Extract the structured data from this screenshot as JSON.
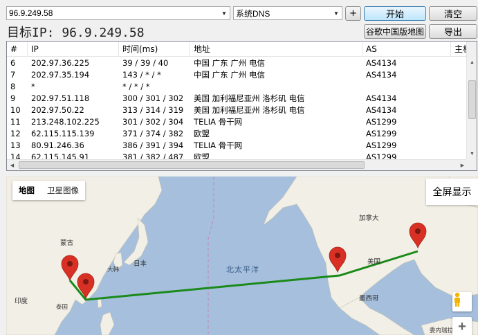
{
  "toolbar": {
    "target_value": "96.9.249.58",
    "dns_value": "系统DNS",
    "plus_label": "+",
    "start_label": "开始",
    "clear_label": "清空",
    "google_map_label": "谷歌中国版地图",
    "export_label": "导出"
  },
  "target_label": "目标IP: 96.9.249.58",
  "table": {
    "headers": [
      "#",
      "IP",
      "时间(ms)",
      "地址",
      "AS",
      "主机"
    ],
    "rows": [
      [
        "6",
        "202.97.36.225",
        "39 / 39 / 40",
        "中国 广东 广州 电信",
        "AS4134"
      ],
      [
        "7",
        "202.97.35.194",
        "143 / * / *",
        "中国 广东 广州 电信",
        "AS4134"
      ],
      [
        "8",
        "*",
        "* / * / *",
        "",
        ""
      ],
      [
        "9",
        "202.97.51.118",
        "300 / 301 / 302",
        "美国 加利福尼亚州 洛杉矶 电信",
        "AS4134"
      ],
      [
        "10",
        "202.97.50.22",
        "313 / 314 / 319",
        "美国 加利福尼亚州 洛杉矶 电信",
        "AS4134"
      ],
      [
        "11",
        "213.248.102.225",
        "301 / 302 / 304",
        "TELIA 骨干网",
        "AS1299"
      ],
      [
        "12",
        "62.115.115.139",
        "371 / 374 / 382",
        "欧盟",
        "AS1299"
      ],
      [
        "13",
        "80.91.246.36",
        "386 / 391 / 394",
        "TELIA 骨干网",
        "AS1299"
      ],
      [
        "14",
        "62.115.145.91",
        "381 / 382 / 487",
        "欧盟",
        "AS1299"
      ]
    ]
  },
  "map": {
    "type_map": "地图",
    "type_satellite": "卫星图像",
    "fullscreen_label": "全屏显示",
    "labels": {
      "mongolia": "蒙古",
      "japan": "日本",
      "south_korea": "大韩",
      "india": "印度",
      "thailand": "泰国",
      "pacific": "北太平洋",
      "canada": "加拿大",
      "usa": "美国",
      "mexico": "墨西哥",
      "venezuela": "委内瑞拉"
    },
    "route_color": "#1a8a1a",
    "land_color": "#f2efe6",
    "water_color": "#a5bfdd",
    "marker_color": "#d93025"
  }
}
